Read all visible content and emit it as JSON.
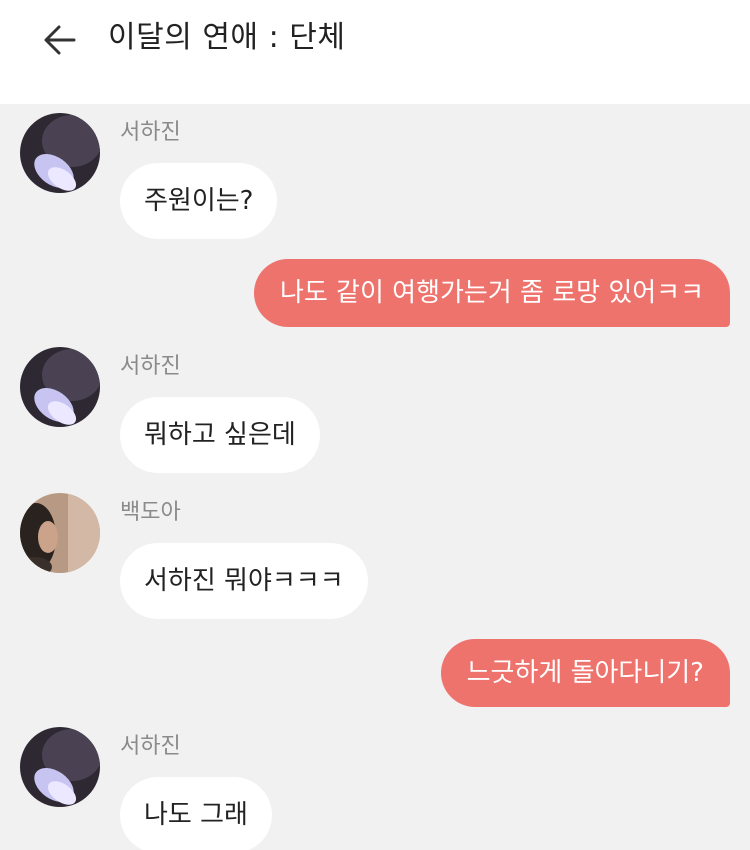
{
  "header": {
    "back_icon": "arrow-left-icon",
    "title": "이달의 연애 : 단체"
  },
  "colors": {
    "outgoing_bubble": "#ee736d",
    "incoming_bubble": "#ffffff",
    "chat_background": "#f1f1f1"
  },
  "messages": [
    {
      "direction": "in",
      "sender": "서하진",
      "text": "주원이는?"
    },
    {
      "direction": "out",
      "text": "나도 같이 여행가는거 좀 로망 있어ㅋㅋ"
    },
    {
      "direction": "in",
      "sender": "서하진",
      "text": "뭐하고 싶은데"
    },
    {
      "direction": "in",
      "sender": "백도아",
      "text": "서하진 뭐야ㅋㅋㅋ"
    },
    {
      "direction": "out",
      "text": "느긋하게 돌아다니기?"
    },
    {
      "direction": "in",
      "sender": "서하진",
      "text": "나도 그래"
    }
  ]
}
